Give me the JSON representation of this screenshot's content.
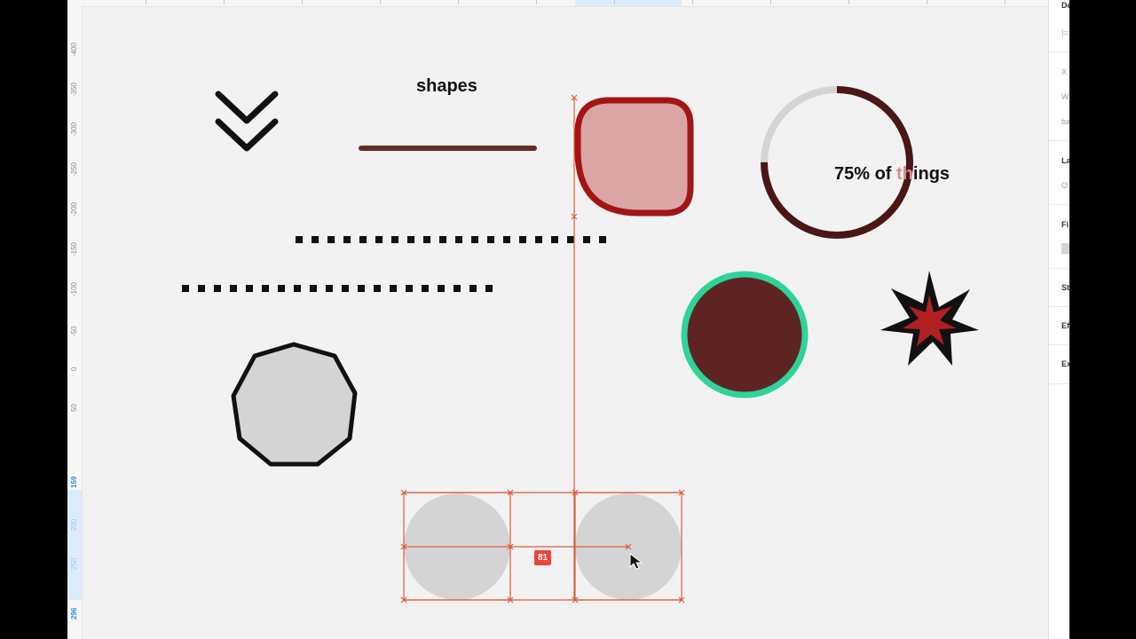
{
  "canvas": {
    "shapes_text": "shapes",
    "progress_label_prefix": "75% of ",
    "progress_label_highlight": "th",
    "progress_label_suffix": "ings",
    "progress_value": 0.75,
    "distance_badge": "81"
  },
  "ruler": {
    "vertical_ticks": [
      "-400",
      "-350",
      "-300",
      "-250",
      "-200",
      "-150",
      "-100",
      "-50",
      "0",
      "50"
    ],
    "selection_ticks": [
      "159",
      "200",
      "250",
      "296"
    ]
  },
  "panel": {
    "items": [
      "De",
      "|=",
      "X",
      "W",
      "ba",
      "La",
      "O",
      "Fi",
      "St",
      "Ef",
      "Ex"
    ]
  },
  "colors": {
    "canvas": "#f2f2f2",
    "dark_red": "#5e2424",
    "accent_red": "#a31515",
    "pink_fill": "#dba5a5",
    "teal": "#2ed39a",
    "selection": "#e05a3a",
    "gray_fill": "#d4d4d4"
  },
  "icons": {
    "chevron": "double-chevron-down-icon",
    "cursor": "cursor-icon"
  }
}
